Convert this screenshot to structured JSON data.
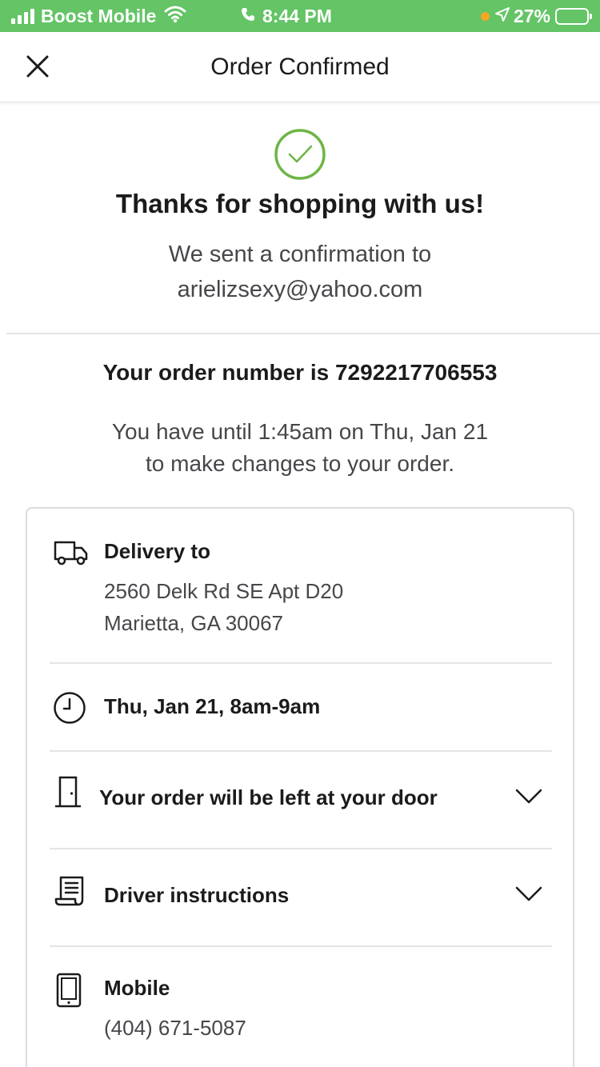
{
  "status_bar": {
    "carrier": "Boost Mobile",
    "time": "8:44 PM",
    "battery_percent": "27%",
    "icons": [
      "signal-icon",
      "wifi-icon",
      "phone-icon",
      "location-arrow-icon",
      "battery-icon"
    ],
    "background_color": "#64c466"
  },
  "header": {
    "title": "Order Confirmed",
    "close_icon": "close-icon"
  },
  "confirmation": {
    "check_icon": "checkmark-circle-icon",
    "accent_color": "#6db545",
    "thanks": "Thanks for shopping with us!",
    "sent_line": "We sent a confirmation to",
    "email": "arielizsexy@yahoo.com"
  },
  "order": {
    "number_line": "Your order number is 7292217706553",
    "change_line_1": "You have until 1:45am on Thu, Jan 21",
    "change_line_2": "to make changes to your order."
  },
  "details": {
    "delivery": {
      "icon": "truck-icon",
      "title": "Delivery to",
      "address_line_1": "2560 Delk Rd SE Apt D20",
      "address_line_2": "Marietta, GA 30067"
    },
    "time_slot": {
      "icon": "clock-icon",
      "title": "Thu, Jan 21, 8am-9am"
    },
    "door": {
      "icon": "door-icon",
      "title": "Your order will be left at your door",
      "chevron": "chevron-down-icon"
    },
    "driver_instructions": {
      "icon": "receipt-icon",
      "title": "Driver instructions",
      "chevron": "chevron-down-icon"
    },
    "mobile": {
      "icon": "mobile-phone-icon",
      "title": "Mobile",
      "phone": "(404) 671-5087"
    }
  }
}
